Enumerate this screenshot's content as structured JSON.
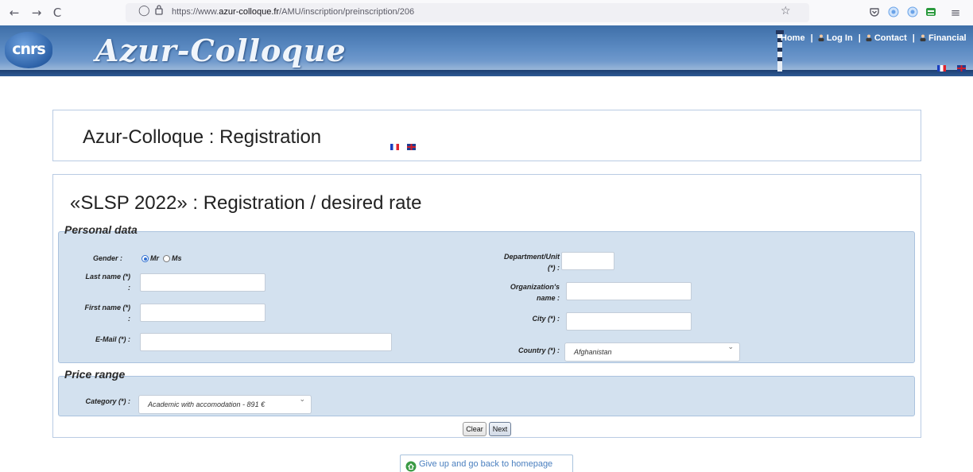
{
  "browser": {
    "back": "←",
    "forward": "→",
    "reload": "C",
    "url_prefix": "https://www.",
    "url_host": "azur-colloque.fr",
    "url_path": "/AMU/inscription/preinscription/206",
    "star": "☆",
    "menu": "≡"
  },
  "banner": {
    "logo_text": "cnrs",
    "site_title": "Azur-Colloque",
    "nav": [
      "Home",
      "Log In",
      "Contact",
      "Financial"
    ]
  },
  "header": {
    "title": "Azur-Colloque : Registration"
  },
  "main": {
    "title": "«SLSP 2022» : Registration / desired rate",
    "personal": {
      "legend": "Personal data",
      "gender_label": "Gender :",
      "gender_options": [
        "Mr",
        "Ms"
      ],
      "gender_selected": "Mr",
      "last_name_label_1": "Last name (*)",
      "last_name_label_2": ":",
      "first_name_label_1": "First name (*)",
      "first_name_label_2": ":",
      "email_label": "E-Mail (*) :",
      "department_label_1": "Department/Unit",
      "department_label_2": "(*) :",
      "organization_label_1": "Organization's",
      "organization_label_2": "name :",
      "city_label": "City (*) :",
      "country_label": "Country (*) :",
      "country_value": "Afghanistan"
    },
    "price": {
      "legend": "Price range",
      "category_label": "Category (*) :",
      "category_value": "Academic with accomodation - 891 €"
    },
    "clear_label": "Clear",
    "next_label": "Next"
  },
  "footer": {
    "giveup_label": "Give up and go back to homepage"
  },
  "colors": {
    "banner_blue": "#3e6fa8",
    "panel_bg": "#d3e1ef",
    "link_blue": "#4a7fbf"
  }
}
